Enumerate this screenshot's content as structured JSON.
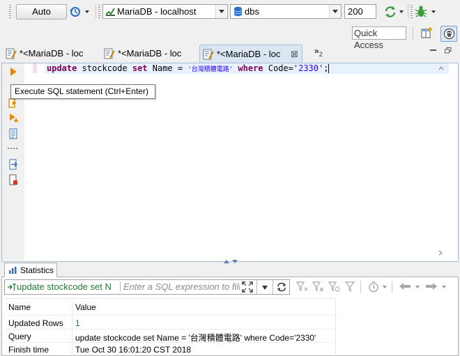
{
  "toolbar": {
    "transaction_mode": "Auto",
    "datasource": "MariaDB - localhost",
    "schema": "dbs",
    "result_limit": "200"
  },
  "quick_access": {
    "label": "Quick Access"
  },
  "editor_tabs": [
    {
      "label": "*<MariaDB - loc"
    },
    {
      "label": "*<MariaDB - loc"
    },
    {
      "label": "*<MariaDB - loc",
      "active": true
    }
  ],
  "overflow_tabs": {
    "count": "2"
  },
  "sql": {
    "kw_update": "update",
    "table": " stockcode ",
    "kw_set": "set",
    "assign": " Name = ",
    "name_literal": "'台灣積體電路'",
    "kw_where": " where ",
    "cond": "Code=",
    "code_literal": "'2330'",
    "end": ";"
  },
  "tooltip": {
    "text": "Execute SQL statement (Ctrl+Enter)"
  },
  "statistics": {
    "tab_label": "Statistics",
    "query_label": "update stockcode set N",
    "filter_placeholder": "Enter a SQL expression to filter",
    "columns": {
      "name": "Name",
      "value": "Value"
    },
    "rows": [
      {
        "name": "Updated Rows",
        "value": "1"
      },
      {
        "name": "Query",
        "value": "update stockcode set Name = '台灣積體電路' where Code='2330'"
      },
      {
        "name": "Finish time",
        "value": "Tue Oct 30 16:01:20 CST 2018"
      }
    ]
  },
  "colors": {
    "keyword": "#7f0055",
    "string": "#2a00ff",
    "active_tab": "#dbe6f3",
    "query_text": "#1f7a3a"
  }
}
